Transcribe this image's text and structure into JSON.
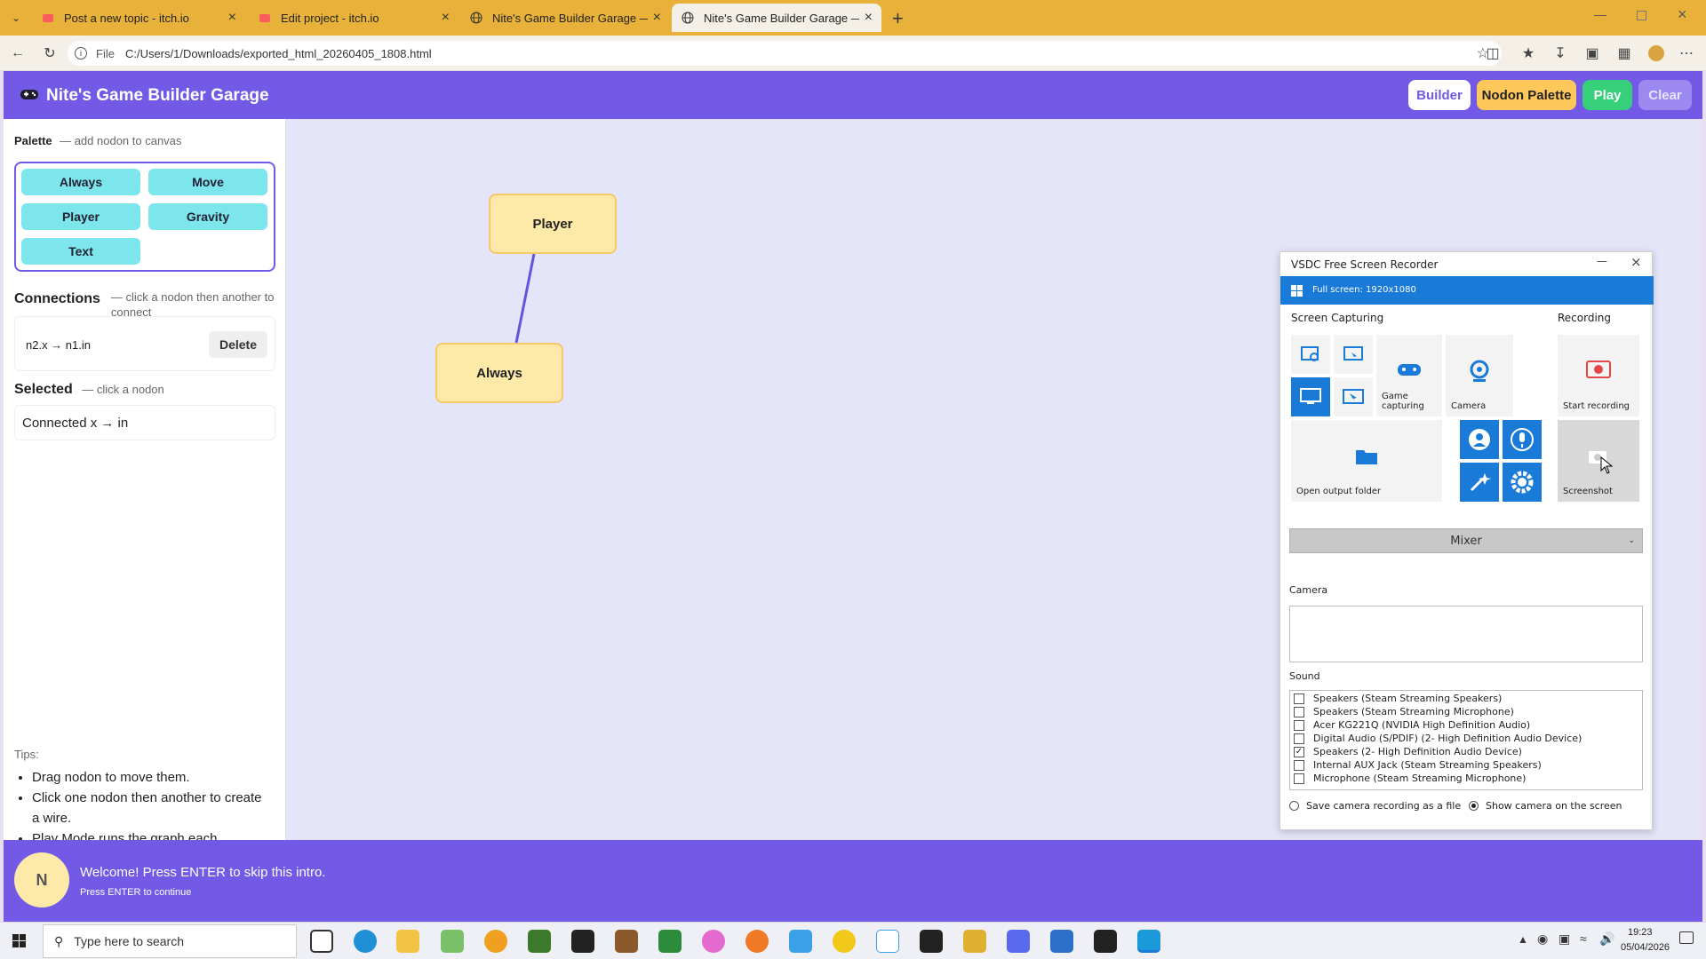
{
  "browser": {
    "tabs": [
      {
        "title": "Post a new topic - itch.io",
        "icon": "itch-icon"
      },
      {
        "title": "Edit project - itch.io",
        "icon": "itch-icon"
      },
      {
        "title": "Nite's Game Builder Garage — De",
        "icon": "globe-icon"
      },
      {
        "title": "Nite's Game Builder Garage — Fix",
        "icon": "globe-icon"
      }
    ],
    "url_prefix": "File",
    "url": "C:/Users/1/Downloads/exported_html_20260405_1808.html"
  },
  "app": {
    "title": "Nite's Game Builder Garage",
    "buttons": {
      "builder": "Builder",
      "palette": "Nodon Palette",
      "play": "Play",
      "clear": "Clear"
    },
    "colors": {
      "header": "#7259e6",
      "builder": "#ffffff",
      "palette": "#ffc85a",
      "play": "#36d07a",
      "clear": "#9c8af0",
      "nodon": "#7de6ec",
      "node": "#fde9a8"
    }
  },
  "sidebar": {
    "palette_title": "Palette",
    "palette_sub": "— add nodon to canvas",
    "palette_items": [
      "Always",
      "Move",
      "Player",
      "Gravity",
      "Text"
    ],
    "connections_title": "Connections",
    "connections_sub": "— click a nodon then another to connect",
    "connection": "n2.x → n1.in",
    "delete_label": "Delete",
    "selected_title": "Selected",
    "selected_sub": "— click a nodon",
    "selected_text": "Connected x → in",
    "tips_title": "Tips:",
    "tips": [
      "Drag nodon to move them.",
      "Click one nodon then another to create a wire.",
      "Play Mode runs the graph each"
    ]
  },
  "canvas": {
    "nodes": [
      "Player",
      "Always"
    ]
  },
  "recorder": {
    "title": "VSDC Free Screen Recorder",
    "mode": "Full screen: 1920x1080",
    "capturing_title": "Screen Capturing",
    "recording_title": "Recording",
    "tiles": {
      "game": "Game capturing",
      "camera": "Camera",
      "start": "Start recording",
      "folder": "Open output folder",
      "screenshot": "Screenshot"
    },
    "mixer": "Mixer",
    "camera_label": "Camera",
    "sound_label": "Sound",
    "sound_devices": [
      {
        "name": "Speakers (Steam Streaming Speakers)",
        "checked": false
      },
      {
        "name": "Speakers (Steam Streaming Microphone)",
        "checked": false
      },
      {
        "name": "Acer KG221Q (NVIDIA High Definition Audio)",
        "checked": false
      },
      {
        "name": "Digital Audio (S/PDIF) (2- High Definition Audio Device)",
        "checked": false
      },
      {
        "name": "Speakers (2- High Definition Audio Device)",
        "checked": true
      },
      {
        "name": "Internal AUX Jack (Steam Streaming Speakers)",
        "checked": false
      },
      {
        "name": "Microphone (Steam Streaming Microphone)",
        "checked": false
      }
    ],
    "radio_save": "Save camera recording as a file",
    "radio_show": "Show camera on the screen"
  },
  "welcome": {
    "avatar": "N",
    "headline": "Welcome! Press ENTER to skip this intro.",
    "subline": "Press ENTER to continue"
  },
  "taskbar": {
    "search_placeholder": "Type here to search",
    "time": "19:23",
    "date": "05/04/2026"
  }
}
